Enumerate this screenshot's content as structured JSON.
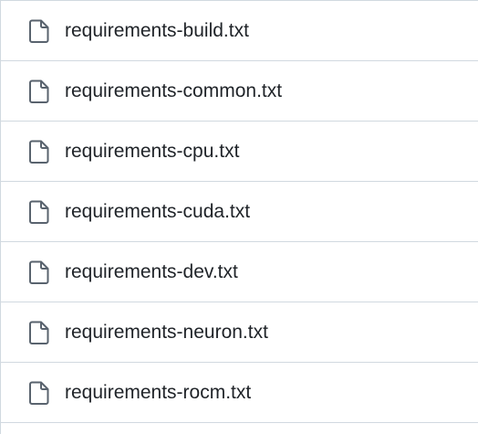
{
  "file_list": {
    "items": [
      {
        "name": "requirements-build.txt",
        "icon": "file-icon"
      },
      {
        "name": "requirements-common.txt",
        "icon": "file-icon"
      },
      {
        "name": "requirements-cpu.txt",
        "icon": "file-icon"
      },
      {
        "name": "requirements-cuda.txt",
        "icon": "file-icon"
      },
      {
        "name": "requirements-dev.txt",
        "icon": "file-icon"
      },
      {
        "name": "requirements-neuron.txt",
        "icon": "file-icon"
      },
      {
        "name": "requirements-rocm.txt",
        "icon": "file-icon"
      }
    ]
  },
  "colors": {
    "text": "#1f2328",
    "icon": "#59636e",
    "border": "#d1d9e0",
    "background": "#ffffff"
  }
}
